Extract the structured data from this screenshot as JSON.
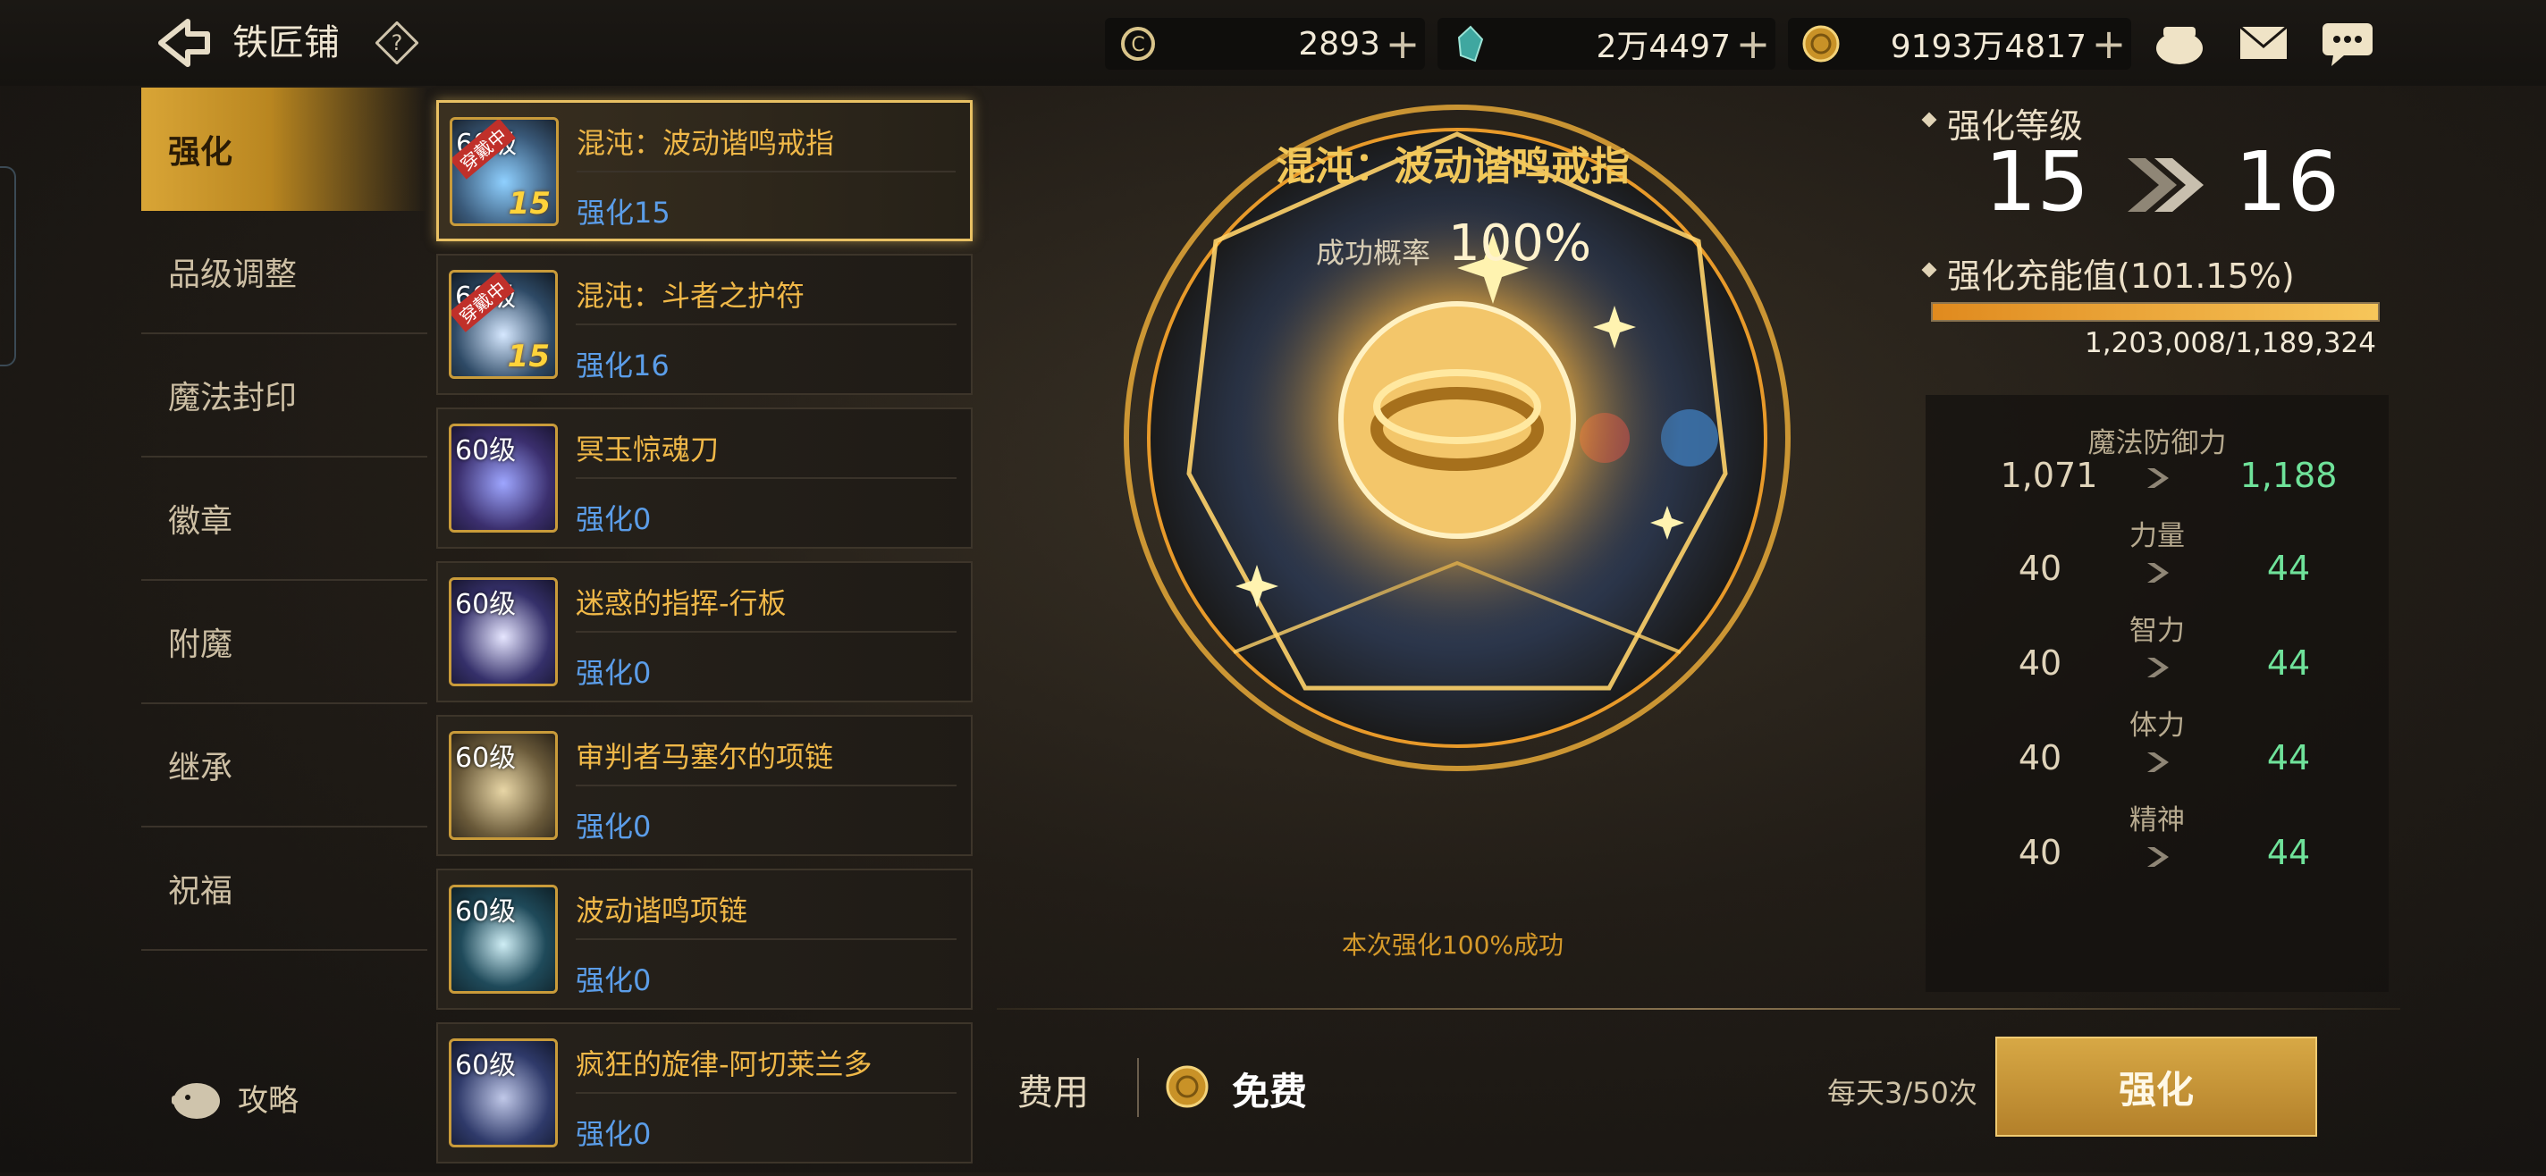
{
  "header": {
    "title": "铁匠铺",
    "help_icon": "question-icon"
  },
  "currencies": [
    {
      "icon": "c-coin-icon",
      "value": "2893"
    },
    {
      "icon": "crystal-icon",
      "value": "2万4497"
    },
    {
      "icon": "gold-coin-icon",
      "value": "9193万4817"
    }
  ],
  "top_icons": [
    "treasure-pot-icon",
    "mail-icon",
    "chat-icon"
  ],
  "menu": [
    {
      "label": "强化",
      "active": true
    },
    {
      "label": "品级调整"
    },
    {
      "label": "魔法封印"
    },
    {
      "label": "徽章"
    },
    {
      "label": "附魔"
    },
    {
      "label": "继承"
    },
    {
      "label": "祝福"
    }
  ],
  "guide": {
    "label": "攻略"
  },
  "items": [
    {
      "level": "60级",
      "badge": "穿戴中",
      "plus": "15",
      "name": "混沌：波动谐鸣戒指",
      "enhance": "强化15",
      "selected": true,
      "color": "#3a5a7a"
    },
    {
      "level": "60级",
      "badge": "穿戴中",
      "plus": "15",
      "name": "混沌：斗者之护符",
      "enhance": "强化16",
      "color": "#2e4a66"
    },
    {
      "level": "60级",
      "name": "冥玉惊魂刀",
      "enhance": "强化0",
      "color": "#3b2f6e"
    },
    {
      "level": "60级",
      "name": "迷惑的指挥-行板",
      "enhance": "强化0",
      "color": "#35306a"
    },
    {
      "level": "60级",
      "name": "审判者马塞尔的项链",
      "enhance": "强化0",
      "color": "#6a5a3a"
    },
    {
      "level": "60级",
      "name": "波动谐鸣项链",
      "enhance": "强化0",
      "color": "#1f4a5a"
    },
    {
      "level": "60级",
      "name": "疯狂的旋律-阿切莱兰多",
      "enhance": "强化0",
      "color": "#2f3a6a"
    }
  ],
  "center": {
    "item_title": "混沌：波动谐鸣戒指",
    "rate_label": "成功概率",
    "rate_value": "100%",
    "notice": "本次强化100%成功"
  },
  "cost": {
    "label": "费用",
    "value": "免费",
    "icon": "gold-coin-icon"
  },
  "daily": "每天3/50次",
  "enhance_button": "强化",
  "level_panel": {
    "label": "强化等级",
    "from": "15",
    "to": "16"
  },
  "charge": {
    "label": "强化充能值(101.15%)",
    "fill_fraction": 1.0,
    "value": "1,203,008/1,189,324"
  },
  "stats": [
    {
      "name": "魔法防御力",
      "old": "1,071",
      "new": "1,188"
    },
    {
      "name": "力量",
      "old": "40",
      "new": "44"
    },
    {
      "name": "智力",
      "old": "40",
      "new": "44"
    },
    {
      "name": "体力",
      "old": "40",
      "new": "44"
    },
    {
      "name": "精神",
      "old": "40",
      "new": "44"
    }
  ],
  "colors": {
    "accent_gold": "#d9a536",
    "enhance_blue": "#5b9de8",
    "item_name": "#f0b848",
    "stat_up": "#6fe29a"
  }
}
